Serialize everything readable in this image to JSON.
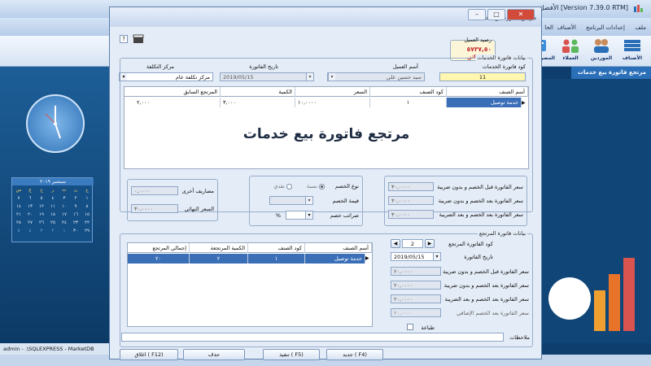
{
  "app": {
    "title": "[Version 7.39.0 RTM] الأفضل",
    "menu": [
      "ملف",
      "إعدادات البرنامج",
      "الأصناف",
      "الحا"
    ],
    "ribbon": [
      "الأصناف",
      "الموردين",
      "العملاء",
      "المصروفات"
    ],
    "doc_tab": "مرتجع فاتورة بيع خدمات",
    "status": "admin  -  .\\SQLEXPRESS  -  MarketDB",
    "calendar": {
      "header": "سبتمبر ٢٠١٩",
      "weekdays": [
        "ح",
        "ن",
        "ث",
        "ر",
        "خ",
        "ج",
        "س"
      ],
      "days": [
        "١",
        "٢",
        "٣",
        "٤",
        "٥",
        "٦",
        "٧",
        "٨",
        "٩",
        "١٠",
        "١١",
        "١٢",
        "١٣",
        "١٤",
        "١٥",
        "١٦",
        "١٧",
        "١٨",
        "١٩",
        "٢٠",
        "٢١",
        "٢٢",
        "٢٣",
        "٢٤",
        "٢٥",
        "٢٦",
        "٢٧",
        "٢٨",
        "٢٩",
        "٣٠",
        "١",
        "٢",
        "٣",
        "٤",
        "٥"
      ]
    }
  },
  "dialog": {
    "title": "مرتجع فاتورة بيع خدمات",
    "balance": {
      "label": "رصيد العميل",
      "value": "٥٧٣٧,٥٠",
      "side": "دائن"
    },
    "invoice_data": {
      "legend": "بيانات فاتورة الخدمات",
      "code_label": "كود فاتورة الخدمات",
      "code_value": "11",
      "customer_label": "أسم العميل",
      "customer_value": "سيد حسين علي",
      "date_label": "تاريخ الفاتورة",
      "date_value": "2019/05/15",
      "cost_center_label": "مركز التكلفة",
      "cost_center_value": "مركز تكلفة عام",
      "columns": [
        "أسم الصنف",
        "كود الصنف",
        "السعر",
        "الكمية",
        "المرتجع السابق"
      ],
      "rows": [
        [
          "خدمة توصيل",
          "١",
          "١٠,٠٠٠٠",
          "٣,٠٠٠",
          "٢,٠٠٠"
        ]
      ],
      "watermark": "مرتجع فاتورة بيع خدمات"
    },
    "totals": {
      "before_discount_label": "سعر الفاتورة قبل الخصم و بدون ضريبة",
      "before_discount_value": "٣٠,٠٠٠٠",
      "after_discount_label": "سعر الفاتورة بعد الخصم و بدون ضريبة",
      "after_discount_value": "٣٠,٠٠٠٠",
      "after_tax_label": "سعر الفاتورة بعد الخصم و بعد الضريبة",
      "after_tax_value": "٣٠,٠٠٠٠"
    },
    "discount": {
      "type_label": "نوع الخصم",
      "percent_label": "نسبة",
      "cash_label": "نقدي",
      "value_label": "قيمة الخصم",
      "tax_label": "ضرائب خصم",
      "percent_sign": "%"
    },
    "expenses": {
      "other_label": "مصاريف أخرى",
      "other_value": "٠,٠٠٠٠",
      "final_label": "السعر النهائي",
      "final_value": "٣٠,٠٠٠٠"
    },
    "return_data": {
      "legend": "بيانات فاتورة المرتجع",
      "code_label": "كود الفاتورة المرتجع",
      "code_value": "2",
      "date_label": "تاريخ الفاتورة",
      "date_value": "2019/05/15",
      "before_label": "سعر الفاتورة قبل الخصم و بدون ضريبة",
      "before_value": "٢٠,٠٠٠٠",
      "after_label": "سعر الفاتورة بعد الخصم و بدون ضريبة",
      "after_value": "٢٠,٠٠٠٠",
      "after_tax_label": "سعر الفاتورة بعد الخصم و بعد الضريبة",
      "after_tax_value": "٢٠,٠٠٠٠",
      "extra_label": "سعر الفاتورة بعد الخصم الإضافي",
      "extra_value": "٢٠,٠٠٠٠",
      "print_label": "طباعة",
      "columns": [
        "أسم الصنف",
        "كود الصنف",
        "الكمية المرتجعة",
        "إجمالي المرتجع"
      ],
      "rows": [
        [
          "خدمة توصيل",
          "١",
          "٢",
          "٢٠"
        ]
      ]
    },
    "notes_label": "ملاحظات",
    "buttons": {
      "new": "جديد ( F4)",
      "save": "تنفيذ ( F5)",
      "delete": "حذف",
      "close": "اغلاق ( F12)"
    },
    "help": "?"
  },
  "colors": {
    "selected_row": "#3a6fb8",
    "accent": "#2a6fb8",
    "code_field": "#fff7b0"
  }
}
